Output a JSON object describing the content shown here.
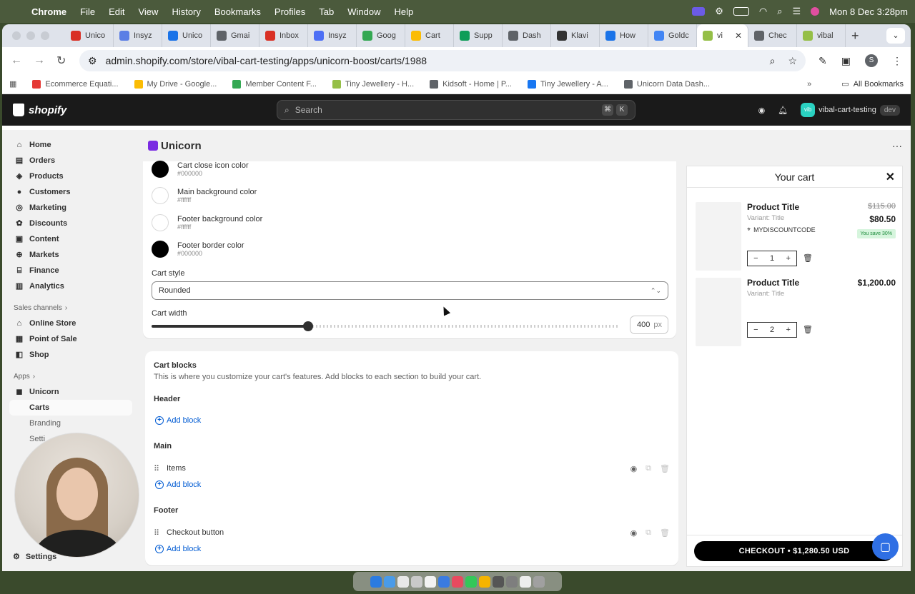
{
  "menubar": {
    "app": "Chrome",
    "items": [
      "File",
      "Edit",
      "View",
      "History",
      "Bookmarks",
      "Profiles",
      "Tab",
      "Window",
      "Help"
    ],
    "datetime": "Mon 8 Dec  3:28pm"
  },
  "tabs": [
    {
      "label": "Unico",
      "color": "#d93025"
    },
    {
      "label": "Insyz",
      "color": "#5b7ee5"
    },
    {
      "label": "Unico",
      "color": "#1a73e8"
    },
    {
      "label": "Gmai",
      "color": "#5f6368"
    },
    {
      "label": "Inbox",
      "color": "#d93025"
    },
    {
      "label": "Insyz",
      "color": "#4c6ef5"
    },
    {
      "label": "Goog",
      "color": "#34a853"
    },
    {
      "label": "Cart",
      "color": "#fbbc04"
    },
    {
      "label": "Supp",
      "color": "#0f9d58"
    },
    {
      "label": "Dash",
      "color": "#5f6368"
    },
    {
      "label": "Klavi",
      "color": "#333333"
    },
    {
      "label": "How",
      "color": "#1a73e8"
    },
    {
      "label": "Goldc",
      "color": "#4285f4"
    },
    {
      "label": "vi",
      "color": "#95bf47",
      "active": true
    },
    {
      "label": "Chec",
      "color": "#5f6368"
    },
    {
      "label": "vibal",
      "color": "#95bf47"
    }
  ],
  "url": "admin.shopify.com/store/vibal-cart-testing/apps/unicorn-boost/carts/1988",
  "profile_initial": "S",
  "bookmarks": [
    {
      "label": "Ecommerce Equati...",
      "color": "#e53935"
    },
    {
      "label": "My Drive - Google...",
      "color": "#fbbc04"
    },
    {
      "label": "Member Content F...",
      "color": "#34a853"
    },
    {
      "label": "Tiny Jewellery - H...",
      "color": "#95bf47"
    },
    {
      "label": "Kidsoft - Home | P...",
      "color": "#5f6368"
    },
    {
      "label": "Tiny Jewellery - A...",
      "color": "#1877f2"
    },
    {
      "label": "Unicorn Data Dash...",
      "color": "#5f6368"
    }
  ],
  "all_bookmarks": "All Bookmarks",
  "shopify": {
    "logo": "shopify",
    "search_placeholder": "Search",
    "kbd1": "⌘",
    "kbd2": "K",
    "store_initials": "vib",
    "store": "vibal-cart-testing",
    "store_tag": "dev"
  },
  "sidebar": {
    "items": [
      "Home",
      "Orders",
      "Products",
      "Customers",
      "Marketing",
      "Discounts",
      "Content",
      "Markets",
      "Finance",
      "Analytics"
    ],
    "sales_channels_label": "Sales channels",
    "channels": [
      "Online Store",
      "Point of Sale",
      "Shop"
    ],
    "apps_label": "Apps",
    "app_name": "Unicorn",
    "app_subs": [
      "Carts",
      "Branding",
      "Setti"
    ],
    "settings": "Settings"
  },
  "page": {
    "title": "Unicorn",
    "more": "···"
  },
  "colors": [
    {
      "label": "Cart close icon color",
      "hex": "#000000"
    },
    {
      "label": "Main background color",
      "hex": "#ffffff"
    },
    {
      "label": "Footer background color",
      "hex": "#ffffff"
    },
    {
      "label": "Footer border color",
      "hex": "#000000"
    }
  ],
  "cart_style": {
    "label": "Cart style",
    "value": "Rounded"
  },
  "cart_width": {
    "label": "Cart width",
    "value": "400",
    "unit": "px",
    "fraction": 0.335
  },
  "cart_blocks": {
    "title": "Cart blocks",
    "description": "This is where you customize your cart's features. Add blocks to each section to build your cart.",
    "add_block": "Add block",
    "sections": [
      {
        "name": "Header",
        "blocks": []
      },
      {
        "name": "Main",
        "blocks": [
          "Items"
        ]
      },
      {
        "name": "Footer",
        "blocks": [
          "Checkout button"
        ]
      }
    ]
  },
  "preview": {
    "title": "Your cart",
    "items": [
      {
        "title": "Product Title",
        "variant": "Variant:  Title",
        "code": "MYDISCOUNTCODE",
        "compare": "$115.00",
        "price": "$80.50",
        "save": "You save 30%",
        "qty": "1"
      },
      {
        "title": "Product Title",
        "variant": "Variant:  Title",
        "price": "$1,200.00",
        "qty": "2"
      }
    ],
    "checkout": "CHECKOUT • $1,280.50 USD"
  }
}
